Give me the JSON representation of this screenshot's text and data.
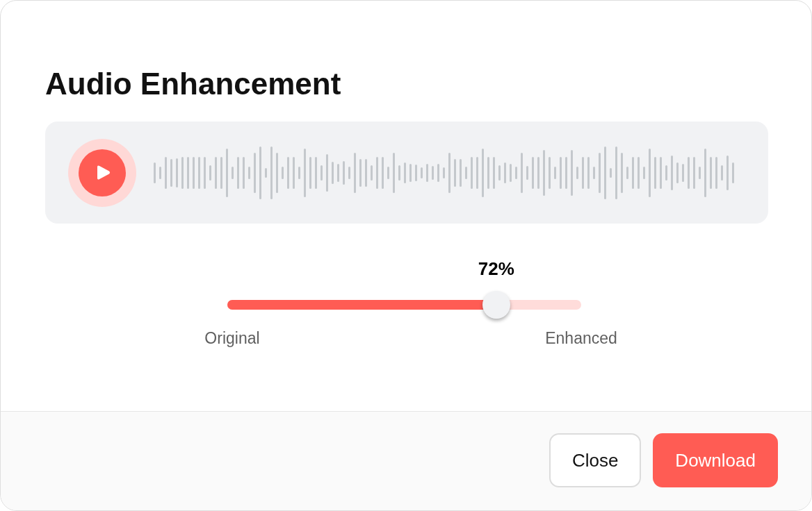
{
  "dialog": {
    "title": "Audio Enhancement"
  },
  "player": {
    "playing": false
  },
  "mix": {
    "value_label": "72%",
    "level": 0.76,
    "min_label": "Original",
    "max_label": "Enhanced"
  },
  "buttons": [
    {
      "label": "Close",
      "kind": "secondary"
    },
    {
      "label": "Download",
      "kind": "primary"
    }
  ]
}
